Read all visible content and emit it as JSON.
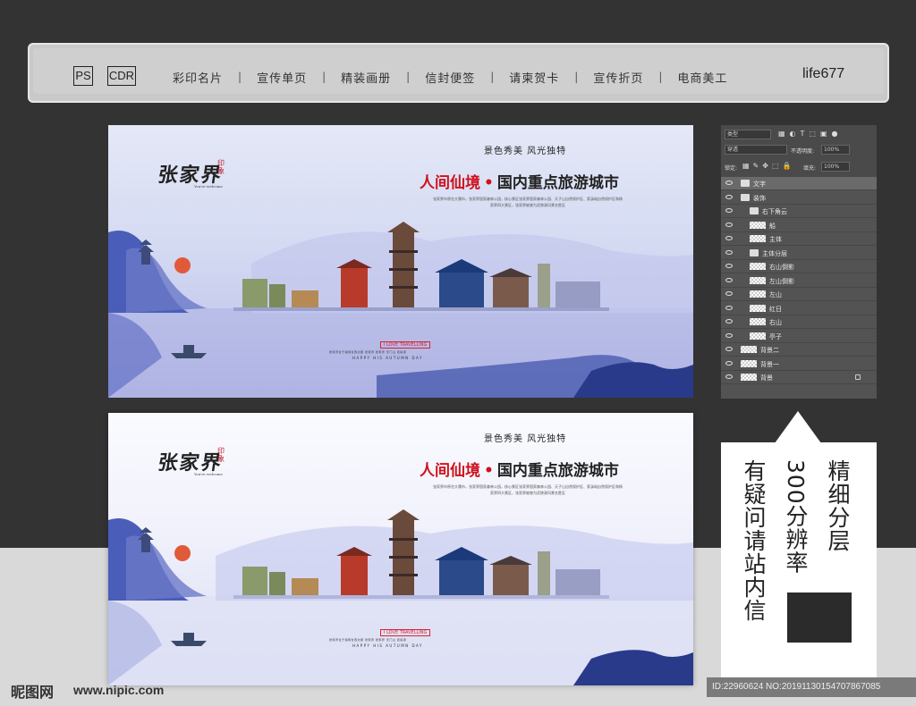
{
  "nav": {
    "badges": [
      "PS",
      "CDR"
    ],
    "items": [
      "彩印名片",
      "宣传单页",
      "精装画册",
      "信封便签",
      "请柬贺卡",
      "宣传折页",
      "电商美工"
    ],
    "separator": "|",
    "brand": "life677"
  },
  "banner": {
    "logo": "张家界",
    "stamp": "印象",
    "welcome": "You're welcome",
    "tagline": "景色秀美 风光独特",
    "title_red": "人间仙境",
    "title_dot": "•",
    "title_dark": "国内重点旅游城市",
    "description": "张家界市原名大庸市，张家界国家森林公园，核心景区张家界国家森林公园、天子山自然保护区、索溪峪自然保护区和杨家界四大景区，张家界被誉为武陵源风景名胜区",
    "love": "I LOVE TRAVELLING",
    "footer_line1": "张家界位于湖南省西北部 张家界 张家界 天门山 武陵源",
    "footer_line2": "HAPPY HIS AUTUMN DAY"
  },
  "layers_panel": {
    "kind_label": "类型",
    "blend_mode": "穿透",
    "opacity_label": "不透明度:",
    "opacity_value": "100%",
    "lock_label": "锁定:",
    "fill_label": "填充:",
    "fill_value": "100%",
    "layers": [
      {
        "name": "文字",
        "type": "folder",
        "selected": true
      },
      {
        "name": "装饰",
        "type": "folder"
      },
      {
        "name": "右下角云",
        "type": "folder"
      },
      {
        "name": "船",
        "type": "layer"
      },
      {
        "name": "主体",
        "type": "layer"
      },
      {
        "name": "主体分层",
        "type": "folder"
      },
      {
        "name": "右山倒影",
        "type": "layer"
      },
      {
        "name": "左山倒影",
        "type": "layer"
      },
      {
        "name": "左山",
        "type": "layer"
      },
      {
        "name": "红日",
        "type": "layer"
      },
      {
        "name": "右山",
        "type": "layer"
      },
      {
        "name": "亭子",
        "type": "layer"
      },
      {
        "name": "背景二",
        "type": "layer"
      },
      {
        "name": "背景一",
        "type": "layer"
      },
      {
        "name": "背景",
        "type": "layer",
        "locked": true
      }
    ]
  },
  "info": {
    "col1": "精细分层",
    "col2": "300分辨率",
    "col3": "有疑问请站内信"
  },
  "watermark": {
    "logo": "昵图网",
    "url": "www.nipic.com",
    "id": "ID:22960624 NO:20191130154707867085"
  },
  "colors": {
    "background": "#333333",
    "accent_red": "#d0101c",
    "mountain_blue": "#4a5db8"
  }
}
